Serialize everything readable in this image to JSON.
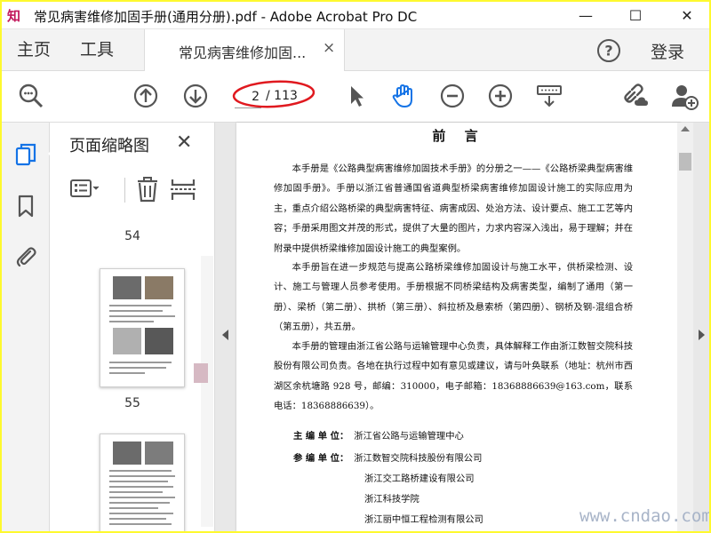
{
  "window": {
    "title": "常见病害维修加固手册(通用分册).pdf - Adobe Acrobat Pro DC",
    "minimize": "—",
    "maximize": "☐",
    "close": "✕"
  },
  "tabs": {
    "home": "主页",
    "tools": "工具",
    "document": "常见病害维修加固...",
    "document_close": "×",
    "login": "登录"
  },
  "toolbar": {
    "page_current": "2",
    "page_total": "/ 113",
    "icons": [
      "zoom-out-search-icon",
      "page-up-icon",
      "page-down-icon",
      "select-arrow-icon",
      "hand-icon",
      "zoom-minus-icon",
      "zoom-plus-icon",
      "keyboard-icon",
      "share-link-icon",
      "add-user-icon"
    ],
    "accent_color": "#1473e6",
    "annotation_color": "#e0191f"
  },
  "rail": {
    "icons": [
      "page-thumbnails-icon",
      "bookmark-icon",
      "attachment-icon"
    ]
  },
  "thumb_panel": {
    "title": "页面缩略图",
    "close": "✕",
    "pages": [
      "54",
      "55"
    ]
  },
  "document": {
    "heading": "前 言",
    "paragraphs": [
      "本手册是《公路典型病害维修加固技术手册》的分册之一——《公路桥梁典型病害维修加固手册》。手册以浙江省普通国省道典型桥梁病害维修加固设计施工的实际应用为主，重点介绍公路桥梁的典型病害特征、病害成因、处治方法、设计要点、施工工艺等内容；手册采用图文并茂的形式，提供了大量的图片，力求内容深入浅出，易于理解；并在附录中提供桥梁维修加固设计施工的典型案例。",
      "本手册旨在进一步规范与提高公路桥梁维修加固设计与施工水平，供桥梁检测、设计、施工与管理人员参考使用。手册根据不同桥梁结构及病害类型，编制了通用（第一册）、梁桥（第二册）、拱桥（第三册）、斜拉桥及悬索桥（第四册）、钢桥及钢-混组合桥（第五册），共五册。",
      "本手册的管理由浙江省公路与运输管理中心负责，具体解释工作由浙江数智交院科技股份有限公司负责。各地在执行过程中如有意见或建议，请与叶奂联系（地址：杭州市西湖区余杭塘路 928 号，邮编：310000，电子邮箱：18368886639@163.com，联系电话：18368886639）。"
    ],
    "chief_label": "主 编 单 位：",
    "chief_unit": "浙江省公路与运输管理中心",
    "co_label": "参 编 单 位：",
    "co_units": [
      "浙江数智交院科技股份有限公司",
      "浙江交工路桥建设有限公司",
      "浙江科技学院",
      "浙江丽中恒工程检测有限公司"
    ]
  },
  "watermark": "www.cndao.com"
}
